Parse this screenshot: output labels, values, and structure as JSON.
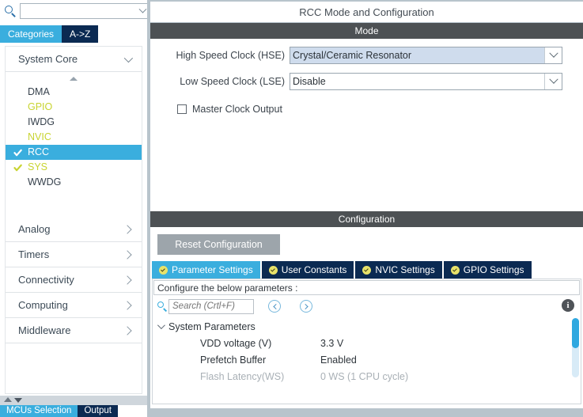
{
  "left_panel": {
    "mcu_search": {
      "value": "",
      "placeholder": ""
    },
    "gear_icon": "gear-icon",
    "search_icon": "search-icon",
    "tabs": [
      {
        "label": "Categories",
        "active": true
      },
      {
        "label": "A->Z",
        "active": false
      }
    ],
    "groups": [
      {
        "label": "System Core",
        "expanded": true
      },
      {
        "label": "Analog",
        "expanded": false
      },
      {
        "label": "Timers",
        "expanded": false
      },
      {
        "label": "Connectivity",
        "expanded": false
      },
      {
        "label": "Computing",
        "expanded": false
      },
      {
        "label": "Middleware",
        "expanded": false
      }
    ],
    "peripherals": [
      {
        "label": "DMA",
        "state": "normal",
        "checked": false,
        "selected": false
      },
      {
        "label": "GPIO",
        "state": "green",
        "checked": false,
        "selected": false
      },
      {
        "label": "IWDG",
        "state": "normal",
        "checked": false,
        "selected": false
      },
      {
        "label": "NVIC",
        "state": "green",
        "checked": false,
        "selected": false
      },
      {
        "label": "RCC",
        "state": "normal",
        "checked": true,
        "selected": true
      },
      {
        "label": "SYS",
        "state": "green",
        "checked": true,
        "selected": false
      },
      {
        "label": "WWDG",
        "state": "normal",
        "checked": false,
        "selected": false
      }
    ],
    "bottom_tabs": [
      {
        "label": "MCUs Selection",
        "active": true
      },
      {
        "label": "Output",
        "active": false
      }
    ]
  },
  "main": {
    "title": "RCC Mode and Configuration",
    "mode": {
      "header": "Mode",
      "fields": [
        {
          "label": "High Speed Clock (HSE)",
          "value": "Crystal/Ceramic Resonator",
          "highlight": true
        },
        {
          "label": "Low Speed Clock (LSE)",
          "value": "Disable",
          "highlight": false
        }
      ],
      "checkbox": {
        "label": "Master Clock Output",
        "checked": false
      }
    },
    "configuration": {
      "header": "Configuration",
      "reset_button": "Reset Configuration",
      "tabs": [
        {
          "label": "Parameter Settings",
          "active": true
        },
        {
          "label": "User Constants",
          "active": false
        },
        {
          "label": "NVIC Settings",
          "active": false
        },
        {
          "label": "GPIO Settings",
          "active": false
        }
      ],
      "configure_label": "Configure the below parameters :",
      "search": {
        "value": "",
        "placeholder": "Search (Crtl+F)"
      },
      "prev_icon": "chevron-left-circle-icon",
      "next_icon": "chevron-right-circle-icon",
      "info_icon": "info-icon",
      "info_glyph": "i",
      "param_group": "System Parameters",
      "params": [
        {
          "name": "VDD voltage (V)",
          "value": "3.3 V",
          "disabled": false
        },
        {
          "name": "Prefetch Buffer",
          "value": "Enabled",
          "disabled": false
        },
        {
          "name": "Flash Latency(WS)",
          "value": "0 WS (1 CPU cycle)",
          "disabled": true
        }
      ]
    }
  },
  "colors": {
    "accent_blue": "#3aaede",
    "dark_navy": "#0b2a52",
    "header_gray": "#4d5154",
    "green_text": "#c8d430",
    "panel_bg": "#b8c4cc",
    "highlight_field": "#cfdced"
  }
}
